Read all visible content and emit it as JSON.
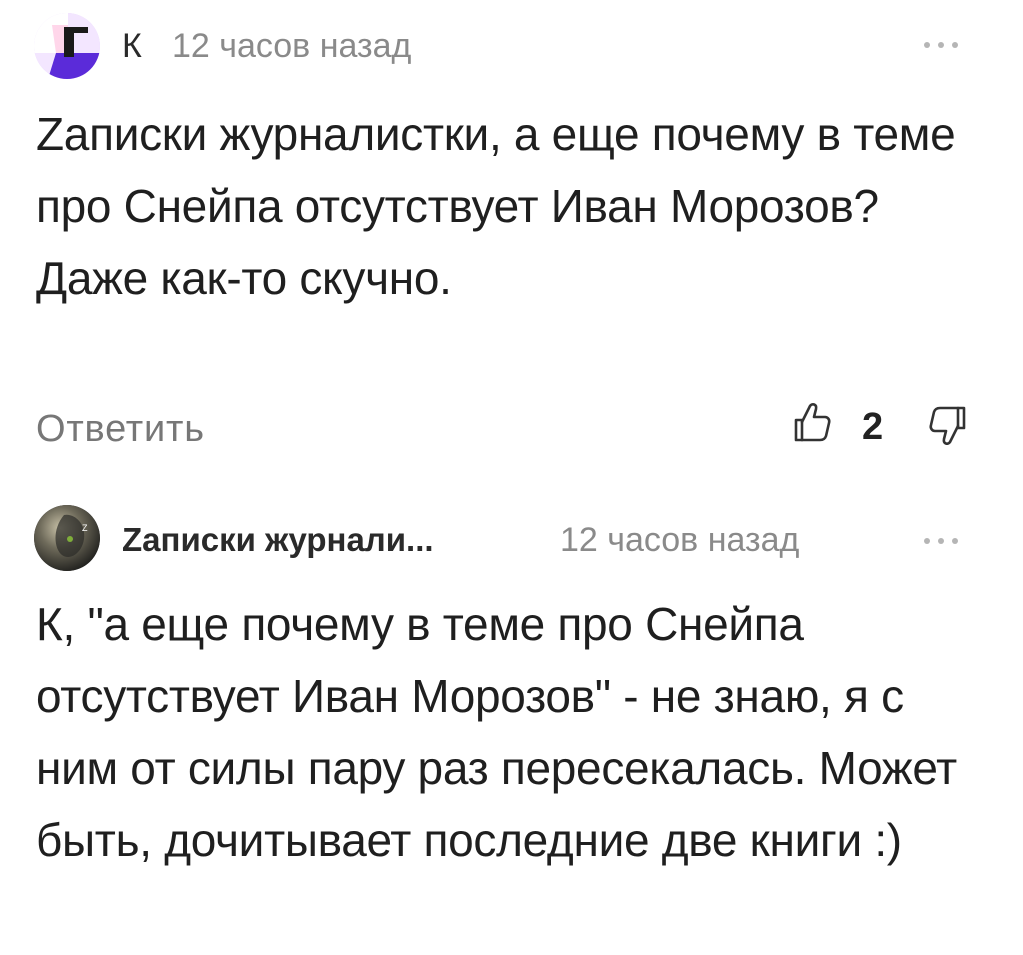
{
  "comments": [
    {
      "author": "К",
      "time": "12 часов назад",
      "text": "Zаписки журналистки, а еще почему в теме про Снейпа отсутствует Иван Морозов? Даже как-то скучно.",
      "reply_label": "Ответить",
      "like_count": "2",
      "avatar_icon": "pink-avatar-icon"
    },
    {
      "author": "Zаписки журнали...",
      "time": "12 часов назад",
      "text": "К, \"а еще почему в теме про Снейпа отсутствует Иван Морозов\" - не знаю, я с ним от силы пару раз пересекалась. Может быть, дочитывает последние две книги :)",
      "avatar_icon": "photo-avatar-icon"
    }
  ],
  "colors": {
    "text": "#1f1f1f",
    "muted": "#8a8a8a",
    "reply": "#777777",
    "avatar_purple": "#7a3cff",
    "avatar_pink": "#ffe0f0"
  }
}
